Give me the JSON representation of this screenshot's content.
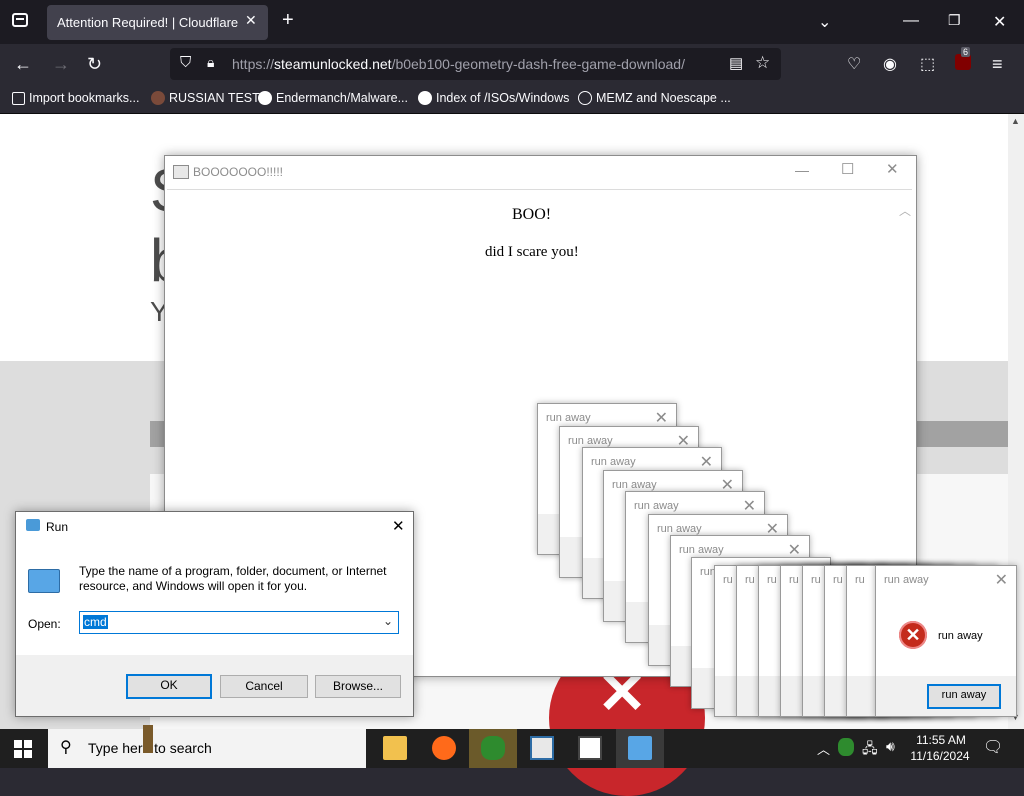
{
  "browser": {
    "tab_title": "Attention Required! | Cloudflare",
    "url_scheme": "https://",
    "url_host": "steamunlocked.net",
    "url_path": "/b0eb100-geometry-dash-free-game-download/",
    "extension_badge": "6",
    "bookmarks": [
      {
        "label": "Import bookmarks...",
        "icon": "import-icon"
      },
      {
        "label": "RUSSIAN TEST",
        "icon": "site-icon"
      },
      {
        "label": "Endermanch/Malware...",
        "icon": "google-icon"
      },
      {
        "label": "Index of /ISOs/Windows",
        "icon": "google-icon"
      },
      {
        "label": "MEMZ and Noescape ...",
        "icon": "globe-icon"
      }
    ]
  },
  "page": {
    "partial_letters": [
      "S",
      "b",
      "Y"
    ]
  },
  "boo_window": {
    "title": "BOOOOOOO!!!!!",
    "heading": "BOO!",
    "message": "did I scare you!"
  },
  "run_away": {
    "title": "run away",
    "message": "run away",
    "button": "run away",
    "partial_title": "ru"
  },
  "run_dialog": {
    "title": "Run",
    "description": "Type the name of a program, folder, document, or Internet resource, and Windows will open it for you.",
    "open_label": "Open:",
    "open_value": "cmd",
    "ok_label": "OK",
    "cancel_label": "Cancel",
    "browse_label": "Browse..."
  },
  "taskbar": {
    "search_placeholder": "Type here to search",
    "time": "11:55 AM",
    "date": "11/16/2024"
  }
}
